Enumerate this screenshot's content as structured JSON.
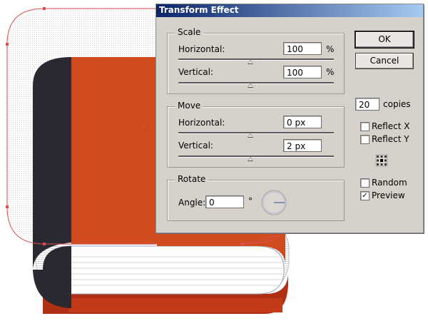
{
  "dialog": {
    "title": "Transform Effect",
    "scale": {
      "label": "Scale",
      "horizontal_label": "Horizontal:",
      "horizontal_value": "100",
      "horizontal_unit": "%",
      "vertical_label": "Vertical:",
      "vertical_value": "100",
      "vertical_unit": "%"
    },
    "move": {
      "label": "Move",
      "horizontal_label": "Horizontal:",
      "horizontal_value": "0 px",
      "vertical_label": "Vertical:",
      "vertical_value": "2 px"
    },
    "rotate": {
      "label": "Rotate",
      "angle_label": "Angle:",
      "angle_value": "0",
      "angle_unit": "°"
    },
    "buttons": {
      "ok": "OK",
      "cancel": "Cancel"
    },
    "copies_value": "20",
    "copies_label": "copies",
    "options": {
      "reflect_x": {
        "label": "Reflect X",
        "checked": false
      },
      "reflect_y": {
        "label": "Reflect Y",
        "checked": false
      },
      "random": {
        "label": "Random",
        "checked": false
      },
      "preview": {
        "label": "Preview",
        "checked": true
      }
    }
  },
  "colors": {
    "book_orange": "#d14b1f",
    "book_dark": "#2a2830",
    "book_bottom_red": "#b03015",
    "selection": "#d85050",
    "dialog_bg": "#d6d2cb"
  },
  "icons": [
    "reference-point-icon",
    "angle-dial-icon"
  ]
}
